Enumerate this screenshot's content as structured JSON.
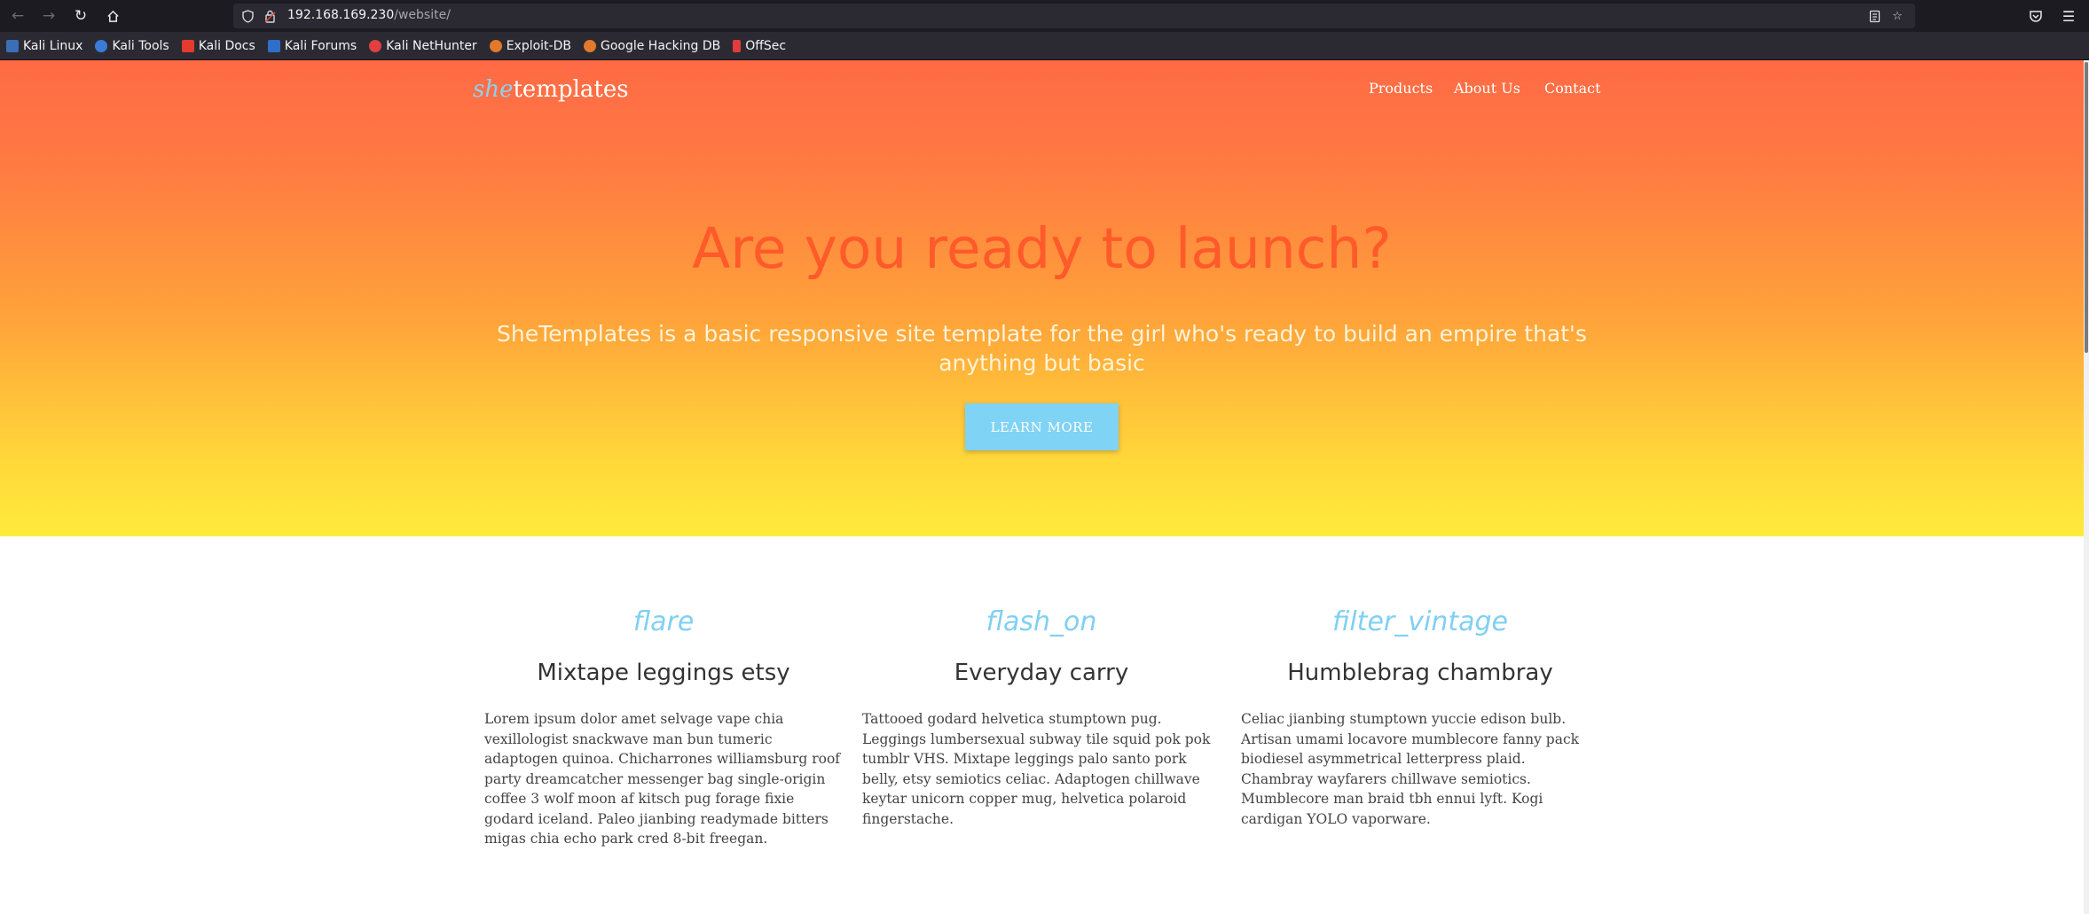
{
  "browser": {
    "url_host": "192.168.169.230",
    "url_path": "/website/",
    "bookmarks": [
      {
        "label": "Kali Linux",
        "color": "#3a6fb7"
      },
      {
        "label": "Kali Tools",
        "color": "#3b7bd6"
      },
      {
        "label": "Kali Docs",
        "color": "#e33b2e"
      },
      {
        "label": "Kali Forums",
        "color": "#2f6fc9"
      },
      {
        "label": "Kali NetHunter",
        "color": "#e04040"
      },
      {
        "label": "Exploit-DB",
        "color": "#e2792b"
      },
      {
        "label": "Google Hacking DB",
        "color": "#e2792b"
      },
      {
        "label": "OffSec",
        "color": "#e23b3b"
      }
    ]
  },
  "site": {
    "logo_she": "she",
    "logo_rest": "templates",
    "nav": {
      "products": "Products",
      "about": "About Us",
      "contact": "Contact"
    },
    "hero": {
      "title": "Are you ready to launch?",
      "subtitle": "SheTemplates is a basic responsive site template for the girl who's ready to build an empire that's anything but basic",
      "button": "LEARN MORE"
    },
    "features": [
      {
        "icon": "flare",
        "title": "Mixtape leggings etsy",
        "text": "Lorem ipsum dolor amet selvage vape chia vexillologist snackwave man bun tumeric adaptogen quinoa. Chicharrones williamsburg roof party dreamcatcher messenger bag single-origin coffee 3 wolf moon af kitsch pug forage fixie godard iceland. Paleo jianbing readymade bitters migas chia echo park cred 8-bit freegan."
      },
      {
        "icon": "flash_on",
        "title": "Everyday carry",
        "text": "Tattooed godard helvetica stumptown pug. Leggings lumbersexual subway tile squid pok pok tumblr VHS. Mixtape leggings palo santo pork belly, etsy semiotics celiac. Adaptogen chillwave keytar unicorn copper mug, helvetica polaroid fingerstache."
      },
      {
        "icon": "filter_vintage",
        "title": "Humblebrag chambray",
        "text": "Celiac jianbing stumptown yuccie edison bulb. Artisan umami locavore mumblecore fanny pack biodiesel asymmetrical letterpress plaid. Chambray wayfarers chillwave semiotics. Mumblecore man braid tbh ennui lyft. Kogi cardigan YOLO vaporware."
      }
    ]
  },
  "colors": {
    "hero_title": "#ff5a2a",
    "accent_blue": "#7fd3f5"
  }
}
